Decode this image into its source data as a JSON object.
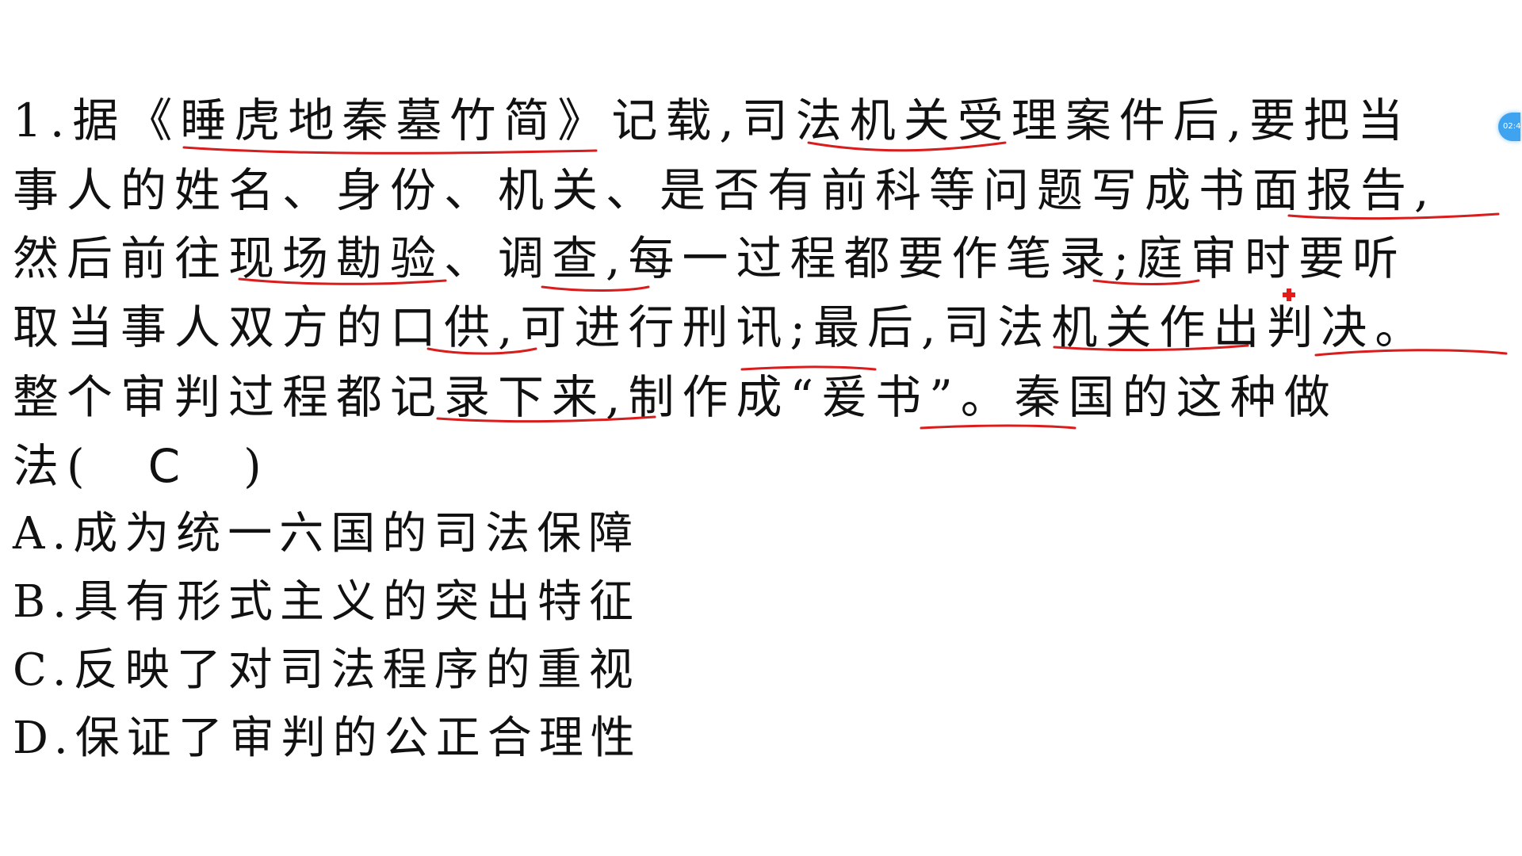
{
  "question": {
    "line1": "1.据《睡虎地秦墓竹简》记载,司法机关受理案件后,要把当",
    "line2": "事人的姓名、身份、机关、是否有前科等问题写成书面报告,",
    "line3": "然后前往现场勘验、调查,每一过程都要作笔录;庭审时要听",
    "line4": "取当事人双方的口供,可进行刑讯;最后,司法机关作出判决。",
    "line5": "整个审判过程都记录下来,制作成“爰书”。秦国的这种做",
    "line6_prefix": "法(",
    "answer": "C",
    "line6_suffix": ")"
  },
  "options": [
    {
      "label": "A.成为统一六国的司法保障"
    },
    {
      "label": "B.具有形式主义的突出特征"
    },
    {
      "label": "C.反映了对司法程序的重视"
    },
    {
      "label": "D.保证了审判的公正合理性"
    }
  ],
  "overlay": {
    "timer_text": "02:4",
    "timer_color": "#3fa3f0",
    "annotation_color": "#d91c1c"
  }
}
